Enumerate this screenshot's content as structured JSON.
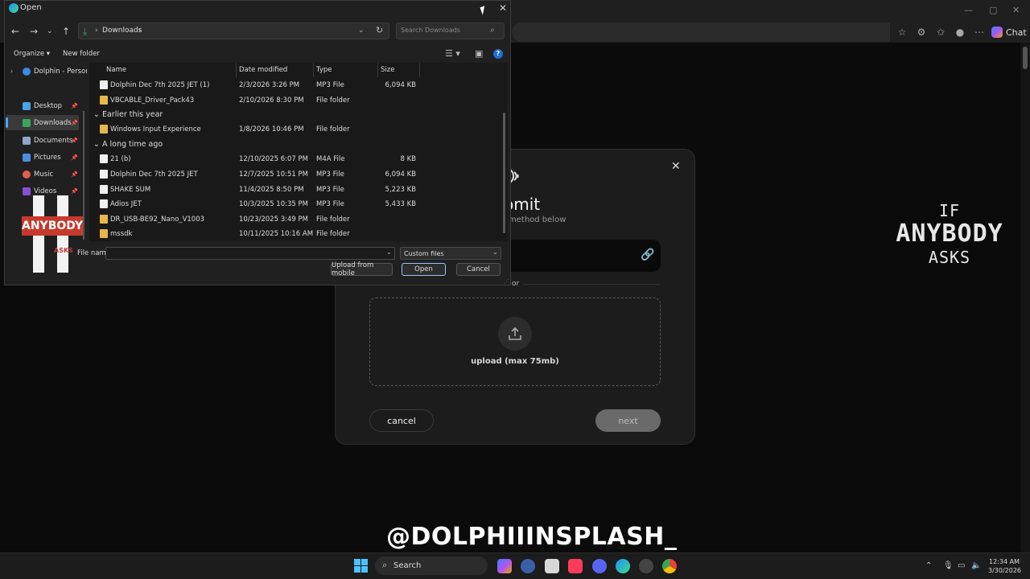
{
  "browser": {
    "chat_label": "Chat"
  },
  "modal": {
    "title": "omit",
    "subtitle": "method below",
    "or_text": "or",
    "upload_label": "upload (max 75mb)",
    "cancel_label": "cancel",
    "next_label": "next"
  },
  "watermark": {
    "if": "IF",
    "anybody": "ANYBODY",
    "asks": "ASKS",
    "sticker_anybody": "ANYBODY",
    "sticker_asks": "ASKS",
    "handle": "@DOLPHIIINSPLASH_"
  },
  "dialog": {
    "title": "Open",
    "address": "Downloads",
    "search_placeholder": "Search Downloads",
    "organize_label": "Organize",
    "new_folder_label": "New folder",
    "nav": [
      {
        "label": "Dolphin - Persoı",
        "color": "#3a8be8"
      },
      {
        "label": "Desktop",
        "color": "#4aa3e8"
      },
      {
        "label": "Downloads",
        "color": "#3ba55d"
      },
      {
        "label": "Documents",
        "color": "#8fa6c4"
      },
      {
        "label": "Pictures",
        "color": "#4a90e2"
      },
      {
        "label": "Music",
        "color": "#e0604f"
      },
      {
        "label": "Videos",
        "color": "#8a4fd8"
      }
    ],
    "columns": {
      "name": "Name",
      "date": "Date modified",
      "type": "Type",
      "size": "Size"
    },
    "rows_top": [
      {
        "name": "Dolphin Dec 7th 2025 JET (1)",
        "date": "2/3/2026 3:26 PM",
        "type": "MP3 File",
        "size": "6,094 KB",
        "kind": "file"
      },
      {
        "name": "VBCABLE_Driver_Pack43",
        "date": "2/10/2026 8:30 PM",
        "type": "File folder",
        "size": "",
        "kind": "folder"
      }
    ],
    "group_earlier": "Earlier this year",
    "rows_earlier": [
      {
        "name": "Windows Input Experience",
        "date": "1/8/2026 10:46 PM",
        "type": "File folder",
        "size": "",
        "kind": "folder"
      }
    ],
    "group_long": "A long time ago",
    "rows_long": [
      {
        "name": "21 (b)",
        "date": "12/10/2025 6:07 PM",
        "type": "M4A File",
        "size": "8 KB",
        "kind": "file"
      },
      {
        "name": "Dolphin Dec 7th 2025 JET",
        "date": "12/7/2025 10:51 PM",
        "type": "MP3 File",
        "size": "6,094 KB",
        "kind": "file"
      },
      {
        "name": "SHAKE SUM",
        "date": "11/4/2025 8:50 PM",
        "type": "MP3 File",
        "size": "5,223 KB",
        "kind": "file"
      },
      {
        "name": "Adios JET",
        "date": "10/3/2025 10:35 PM",
        "type": "MP3 File",
        "size": "5,433 KB",
        "kind": "file"
      },
      {
        "name": "DR_USB-BE92_Nano_V1003",
        "date": "10/23/2025 3:49 PM",
        "type": "File folder",
        "size": "",
        "kind": "folder"
      },
      {
        "name": "mssdk",
        "date": "10/11/2025 10:16 AM",
        "type": "File folder",
        "size": "",
        "kind": "folder"
      }
    ],
    "file_name_label": "File name:",
    "file_name_value": "",
    "filter_value": "Custom files",
    "upload_mobile_label": "Upload from mobile",
    "open_label": "Open",
    "cancel_label": "Cancel"
  },
  "taskbar": {
    "search_label": "Search",
    "time": "12:34 AM",
    "date": "3/30/2026"
  }
}
